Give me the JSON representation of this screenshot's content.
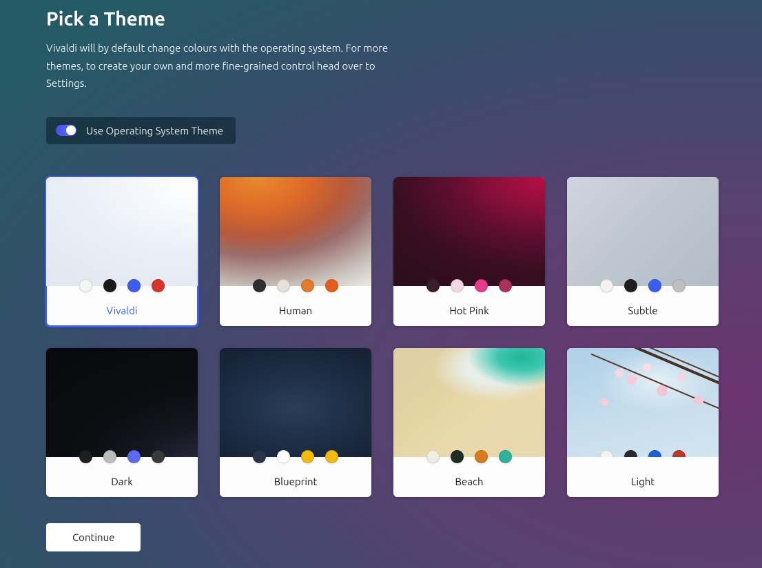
{
  "header": {
    "title": "Pick a Theme",
    "subtitle": "Vivaldi will by default change colours with the operating system. For more themes, to create your own and more fine-grained control head over to Settings."
  },
  "os_toggle": {
    "label": "Use Operating System Theme",
    "enabled": true
  },
  "themes": [
    {
      "id": "vivaldi",
      "label": "Vivaldi",
      "selected": true,
      "preview_class": "pv-vivaldi",
      "swatches": [
        "#f4f5f5",
        "#1a1a1a",
        "#3b5cf0",
        "#d4342a"
      ]
    },
    {
      "id": "human",
      "label": "Human",
      "selected": false,
      "preview_class": "pv-human",
      "swatches": [
        "#2e2e2e",
        "#e6e1d9",
        "#e07a2f",
        "#e25f1e"
      ]
    },
    {
      "id": "hotpink",
      "label": "Hot Pink",
      "selected": false,
      "preview_class": "pv-hotpink",
      "swatches": [
        "#3b1e28",
        "#f2d8e4",
        "#e83a8c",
        "#a8325a"
      ]
    },
    {
      "id": "subtle",
      "label": "Subtle",
      "selected": false,
      "preview_class": "pv-subtle",
      "swatches": [
        "#f2f2f2",
        "#1e1e1e",
        "#3b5cf0",
        "#bfbfbf"
      ]
    },
    {
      "id": "dark",
      "label": "Dark",
      "selected": false,
      "preview_class": "pv-dark",
      "swatches": [
        "#1e1e1e",
        "#bcbcbc",
        "#5a6af4",
        "#3a3a3a"
      ]
    },
    {
      "id": "blueprint",
      "label": "Blueprint",
      "selected": false,
      "preview_class": "pv-blueprint",
      "swatches": [
        "#28344a",
        "#ffffff",
        "#f2b90f",
        "#f2b90f"
      ]
    },
    {
      "id": "beach",
      "label": "Beach",
      "selected": false,
      "preview_class": "pv-beach",
      "swatches": [
        "#f0eee4",
        "#1e2e24",
        "#d87a1f",
        "#2fb39a"
      ]
    },
    {
      "id": "light",
      "label": "Light",
      "selected": false,
      "preview_class": "pv-light",
      "swatches": [
        "#f2f2f2",
        "#2a2a2a",
        "#1f5fd8",
        "#b83a2f"
      ]
    }
  ],
  "buttons": {
    "continue": "Continue"
  }
}
